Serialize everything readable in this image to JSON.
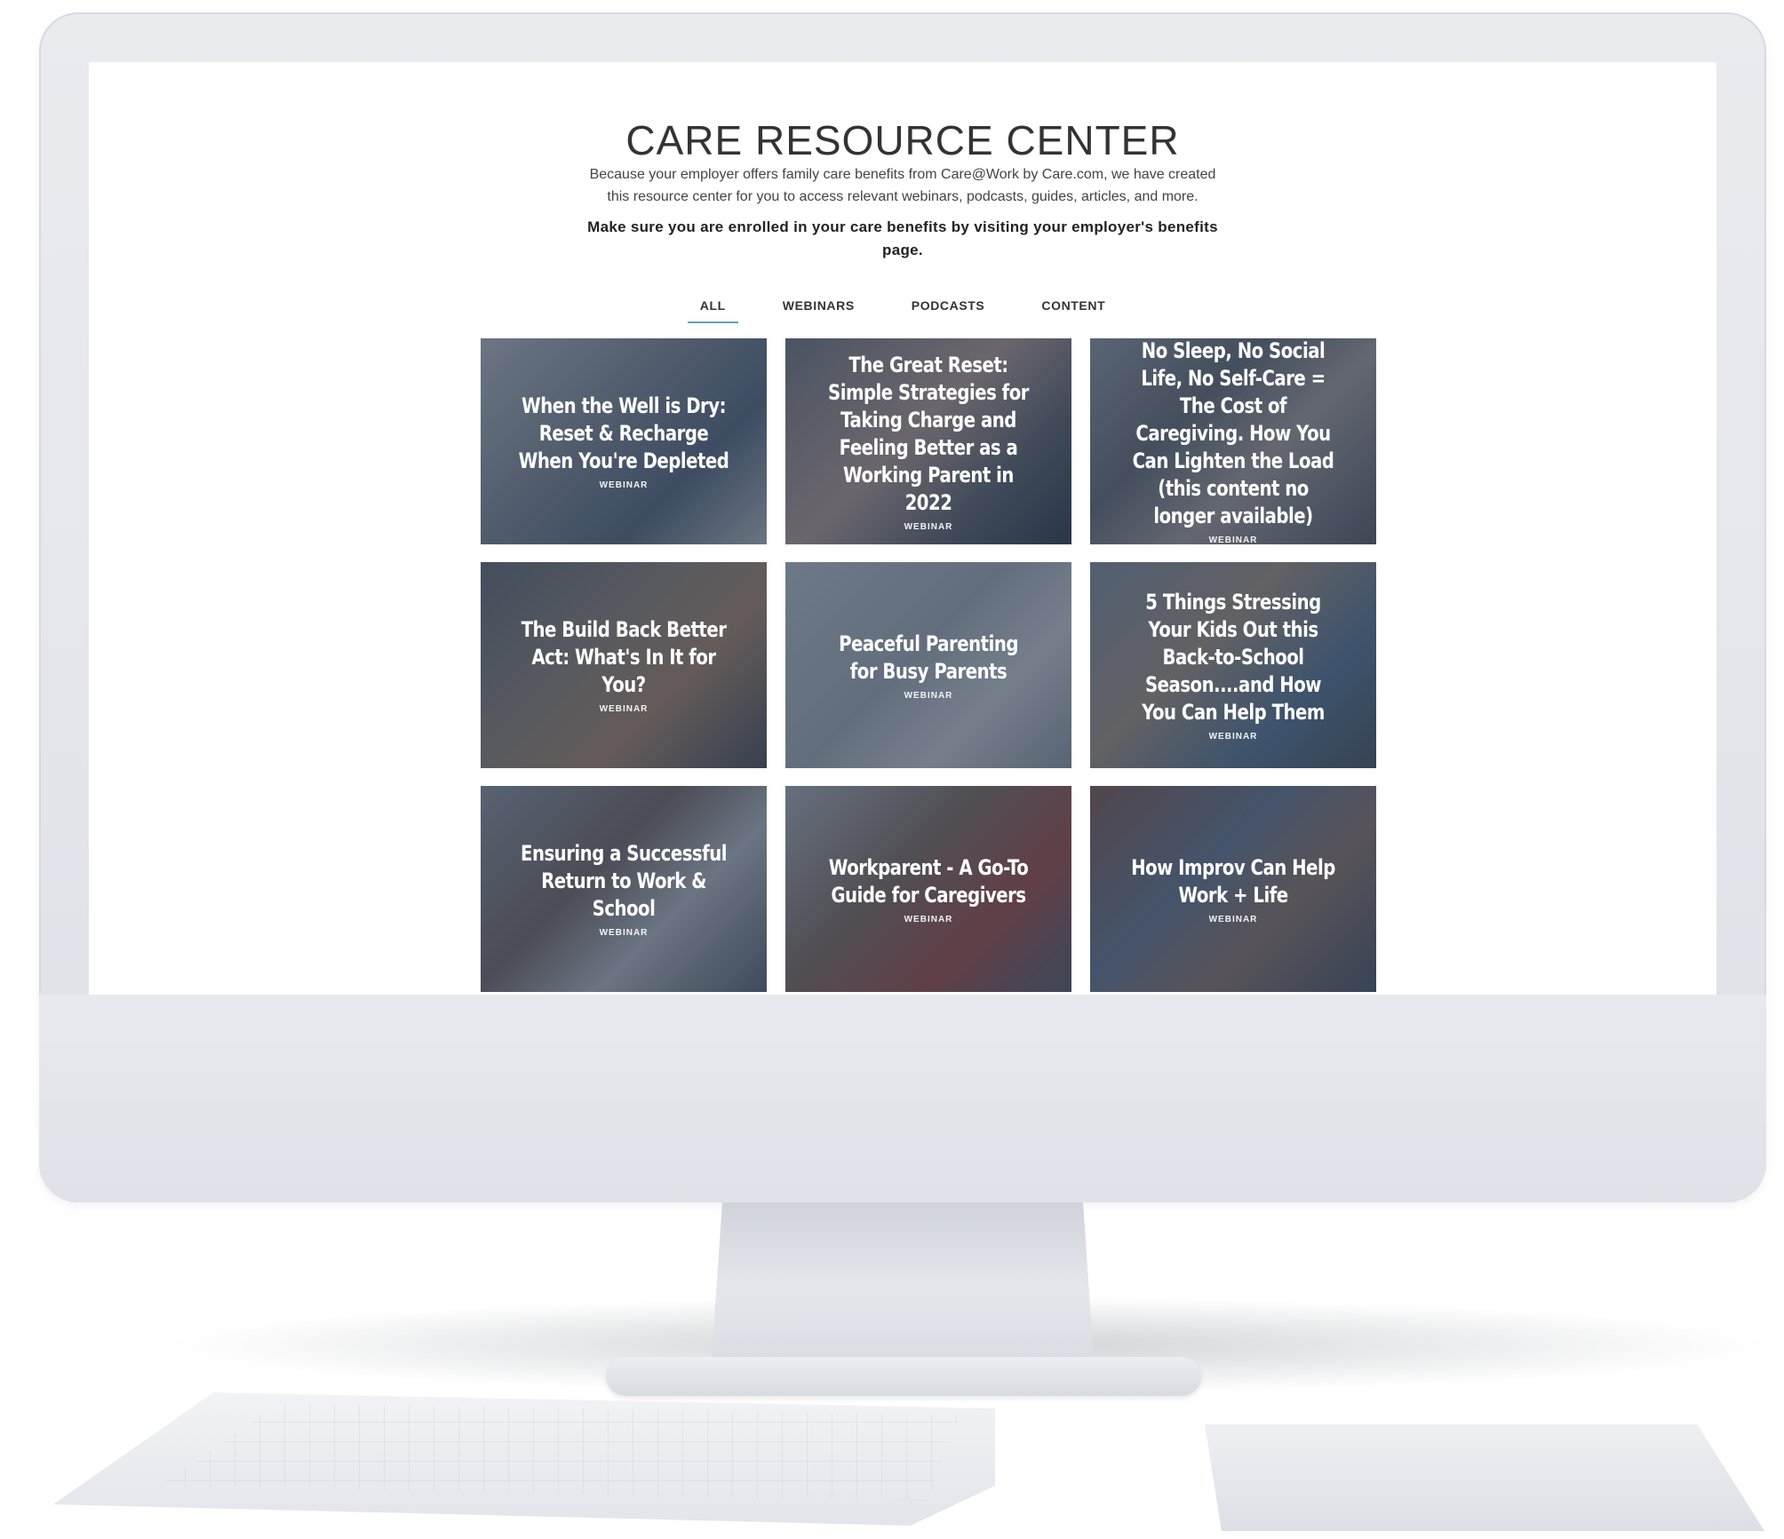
{
  "page": {
    "title": "CARE RESOURCE CENTER",
    "intro": "Because your employer offers family care benefits from Care@Work by Care.com, we have created this resource center for you to access relevant webinars, podcasts, guides, articles, and more.",
    "notice": "Make sure you are enrolled in your care benefits by visiting your employer's benefits page."
  },
  "tabs": [
    {
      "label": "ALL",
      "active": true
    },
    {
      "label": "WEBINARS",
      "active": false
    },
    {
      "label": "PODCASTS",
      "active": false
    },
    {
      "label": "CONTENT",
      "active": false
    }
  ],
  "cards": [
    {
      "title": "When the Well is Dry: Reset & Recharge When You're Depleted",
      "type": "WEBINAR"
    },
    {
      "title": "The Great Reset: Simple Strategies for Taking Charge and Feeling Better as a Working Parent in 2022",
      "type": "WEBINAR"
    },
    {
      "title": "No Sleep, No Social Life, No Self-Care = The Cost of Caregiving. How You Can Lighten the Load (this content no longer available)",
      "type": "WEBINAR"
    },
    {
      "title": "The Build Back Better Act: What's In It for You?",
      "type": "WEBINAR"
    },
    {
      "title": "Peaceful Parenting for Busy Parents",
      "type": "WEBINAR"
    },
    {
      "title": "5 Things Stressing Your Kids Out this Back-to-School Season....and How You Can Help Them",
      "type": "WEBINAR"
    },
    {
      "title": "Ensuring a Successful Return to Work & School",
      "type": "WEBINAR"
    },
    {
      "title": "Workparent - A Go-To Guide for Caregivers",
      "type": "WEBINAR"
    },
    {
      "title": "How Improv Can Help Work + Life",
      "type": "WEBINAR"
    }
  ]
}
